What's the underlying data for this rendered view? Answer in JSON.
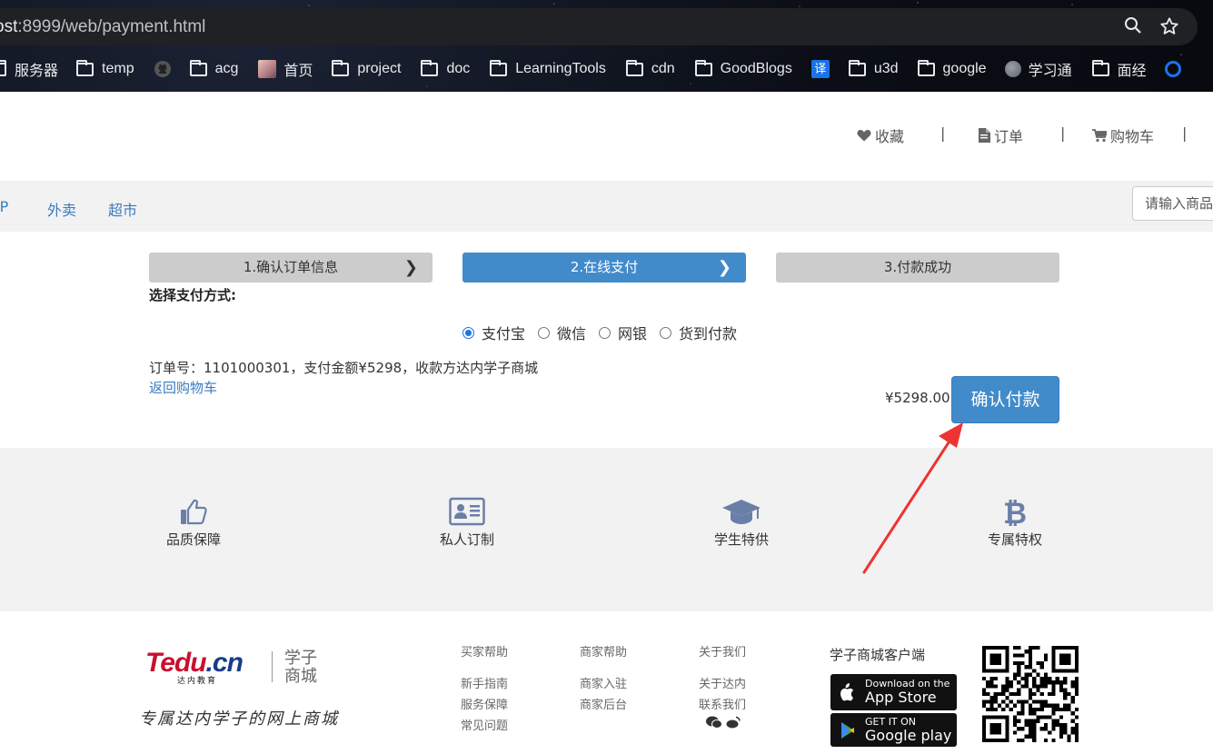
{
  "browser": {
    "url_host": "ost",
    "url_rest": ":8999/web/payment.html",
    "bookmarks": [
      "服务器",
      "temp",
      "acg",
      "首页",
      "project",
      "doc",
      "LearningTools",
      "cdn",
      "GoodBlogs",
      "译",
      "u3d",
      "google",
      "学习通",
      "面经"
    ]
  },
  "topnav": {
    "favorites": "收藏",
    "orders": "订单",
    "cart": "购物车",
    "separator": "|"
  },
  "categories": {
    "vip": "VIP",
    "takeout": "外卖",
    "market": "超市"
  },
  "search": {
    "placeholder": "请输入商品"
  },
  "steps": [
    {
      "label": "1.确认订单信息"
    },
    {
      "label": "2.在线支付",
      "active": true
    },
    {
      "label": "3.付款成功"
    }
  ],
  "payment": {
    "title": "选择支付方式:",
    "methods": [
      "支付宝",
      "微信",
      "网银",
      "货到付款"
    ],
    "selected": "支付宝",
    "order_info": "订单号：1101000301，支付金额¥5298，收款方达内学子商城",
    "back_link": "返回购物车",
    "amount": "¥5298.00",
    "confirm_label": "确认付款"
  },
  "features": [
    "品质保障",
    "私人订制",
    "学生特供",
    "专属特权"
  ],
  "footer": {
    "logo_main_a": "Tedu",
    "logo_main_b": ".cn",
    "logo_sub": "达内教育",
    "logo_cn": "学子\n商城",
    "slogan": "专属达内学子的网上商城",
    "columns": [
      {
        "head": "买家帮助",
        "links": [
          "新手指南",
          "服务保障",
          "常见问题"
        ]
      },
      {
        "head": "商家帮助",
        "links": [
          "商家入驻",
          "商家后台"
        ]
      },
      {
        "head": "关于我们",
        "links": [
          "关于达内",
          "联系我们"
        ]
      }
    ],
    "client_title": "学子商城客户端",
    "appstore_small": "Download on the",
    "appstore_big": "App Store",
    "googleplay_small": "GET IT ON",
    "googleplay_big": "Google play"
  },
  "colors": {
    "primary": "#428bca",
    "link": "#3a7bbf",
    "annotation": "#ee3333"
  }
}
